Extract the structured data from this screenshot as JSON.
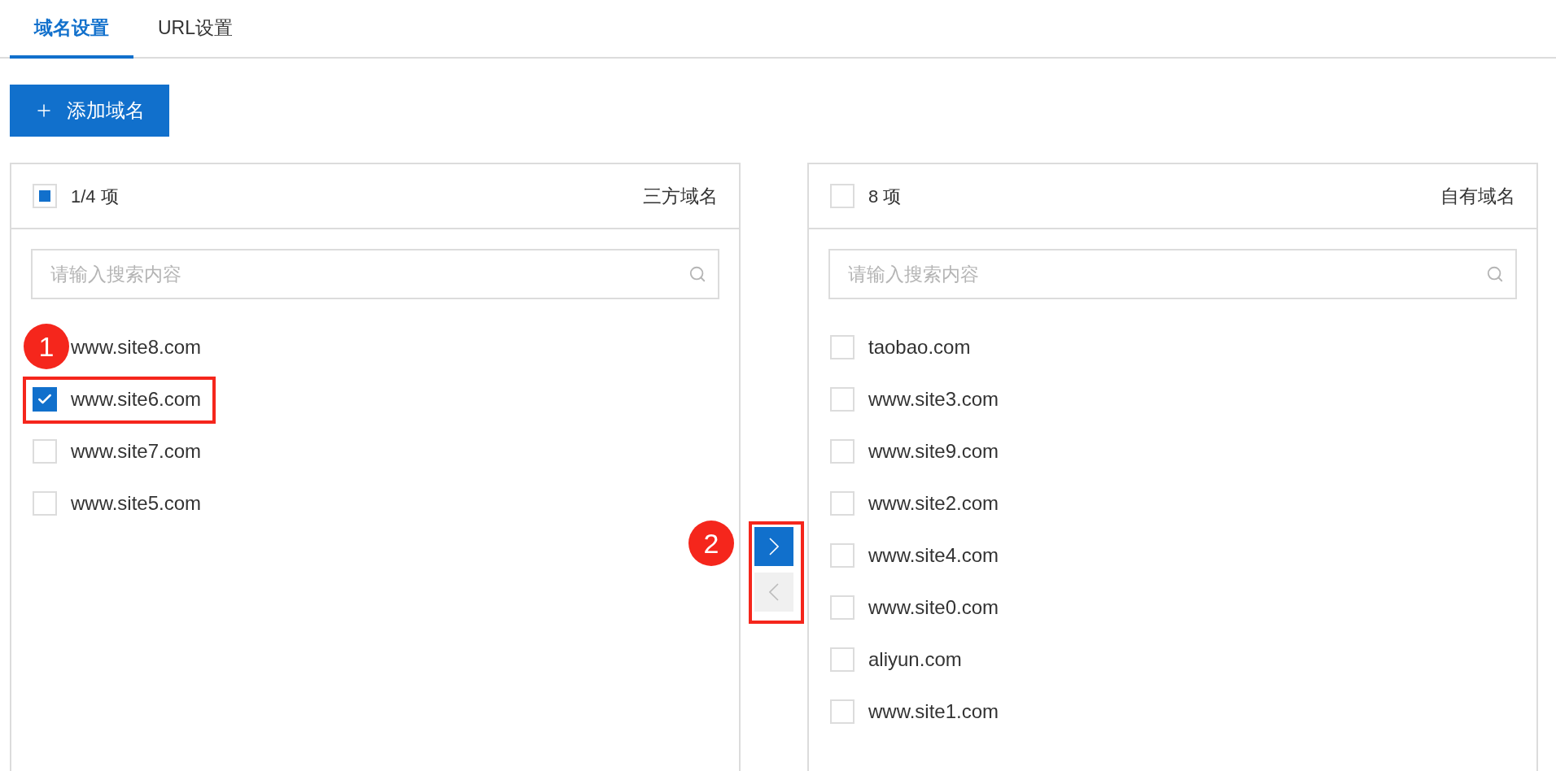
{
  "tabs": [
    {
      "label": "域名设置",
      "selected": true
    },
    {
      "label": "URL设置",
      "selected": false
    }
  ],
  "add_button": {
    "label": "添加域名"
  },
  "panels": [
    {
      "count": "1/4 项",
      "title": "三方域名",
      "all_checked": false,
      "indeterminate": true,
      "search": {
        "placeholder": "请输入搜索内容"
      },
      "items": [
        {
          "label": "www.site8.com"
        },
        {
          "label": "www.site6.com",
          "checked": true
        },
        {
          "label": "www.site7.com",
          "checked": false
        },
        {
          "label": "www.site5.com",
          "checked": false
        }
      ]
    },
    {
      "count": "8 项",
      "title": "自有域名",
      "all_checked": false,
      "indeterminate": false,
      "search": {
        "placeholder": "请输入搜索内容"
      },
      "items": [
        {
          "label": "taobao.com",
          "checked": false
        },
        {
          "label": "www.site3.com",
          "checked": false
        },
        {
          "label": "www.site9.com",
          "checked": false
        },
        {
          "label": "www.site2.com",
          "checked": false
        },
        {
          "label": "www.site4.com",
          "checked": false
        },
        {
          "label": "www.site0.com",
          "checked": false
        },
        {
          "label": "aliyun.com",
          "checked": false
        },
        {
          "label": "www.site1.com",
          "checked": false
        }
      ]
    }
  ],
  "transfer_buttons": [
    {
      "kind": "forward",
      "disabled": false
    },
    {
      "kind": "back",
      "disabled": true
    }
  ],
  "annotations": [
    {
      "number": "1"
    },
    {
      "number": "2"
    }
  ]
}
